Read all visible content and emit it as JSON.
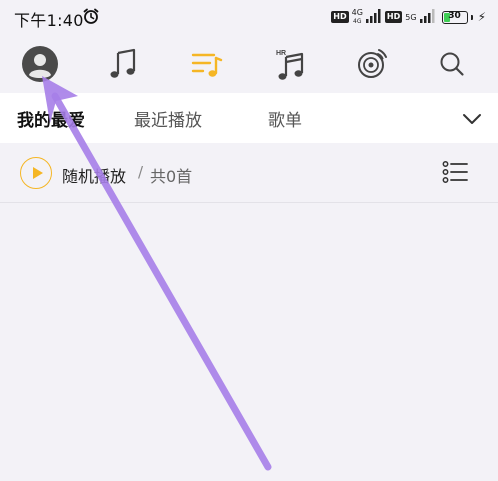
{
  "status_bar": {
    "time": "下午1:40",
    "hd_label": "HD",
    "net_1": "4G",
    "net_1_sub": "4G",
    "net_2": "5G",
    "battery": "30",
    "battery_level_percent": 30
  },
  "top_nav": {
    "active_index": 2,
    "items": [
      {
        "icon": "avatar-icon"
      },
      {
        "icon": "music-note-icon"
      },
      {
        "icon": "playlist-icon"
      },
      {
        "icon": "hr-music-icon",
        "badge": "HR"
      },
      {
        "icon": "radio-disc-icon"
      },
      {
        "icon": "search-icon"
      }
    ]
  },
  "tabs": {
    "items": [
      "我的最爱",
      "最近播放",
      "歌单"
    ],
    "active_index": 0
  },
  "play_row": {
    "label": "随机播放",
    "separator": "/",
    "count": "共0首"
  },
  "colors": {
    "accent": "#f5b625",
    "background": "#f3f2f7",
    "tab_background": "#ffffff",
    "annotation_arrow": "#a67ee8"
  }
}
